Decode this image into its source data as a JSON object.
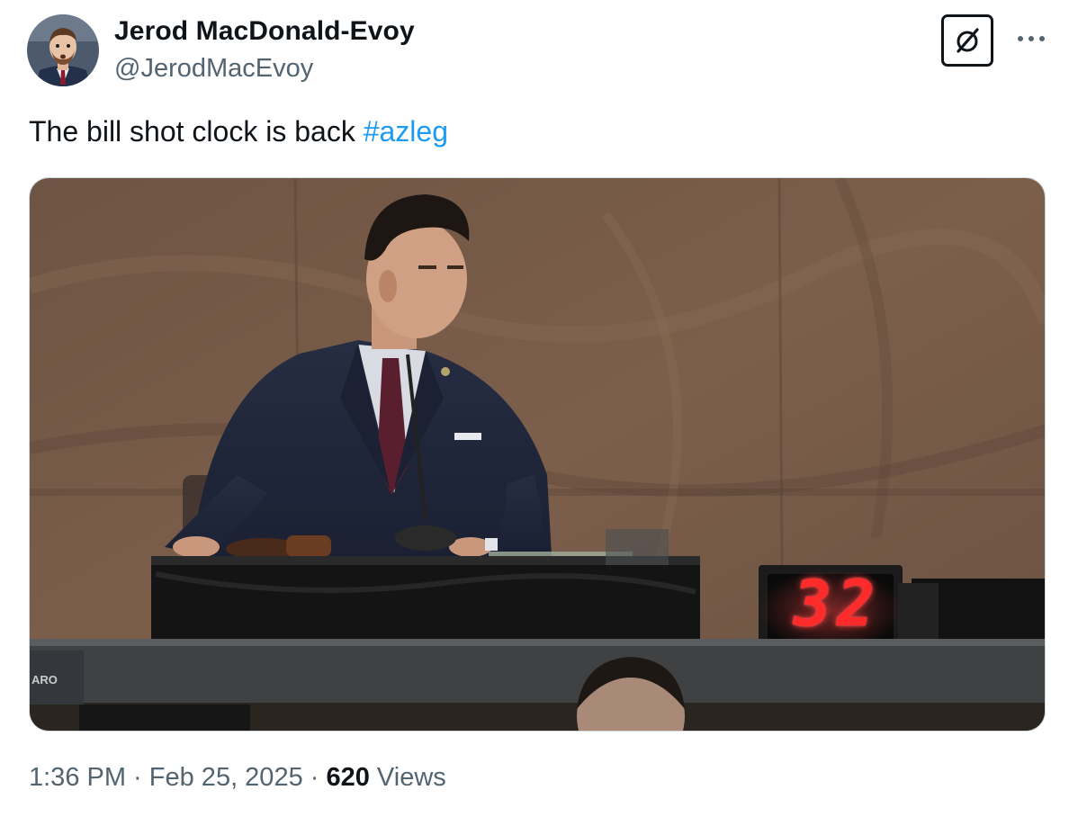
{
  "author": {
    "display_name": "Jerod MacDonald-Evoy",
    "handle": "@JerodMacEvoy",
    "avatar_icon": "profile-photo"
  },
  "header_actions": {
    "grok_icon": "grok-slash-circle-icon",
    "more_icon": "more-dots-icon"
  },
  "tweet": {
    "text": "The bill shot clock is back ",
    "hashtag": "#azleg"
  },
  "media": {
    "clock_display": "32",
    "nameplate_text": "ARO"
  },
  "meta": {
    "time": "1:36 PM",
    "separator1": " · ",
    "date": "Feb 25, 2025",
    "separator2": " · ",
    "views_count": "620",
    "views_label": " Views"
  },
  "colors": {
    "hashtag": "#1d9bf0",
    "secondary_text": "#536471",
    "primary_text": "#0f1419",
    "clock_digits": "#ff2a2a"
  }
}
